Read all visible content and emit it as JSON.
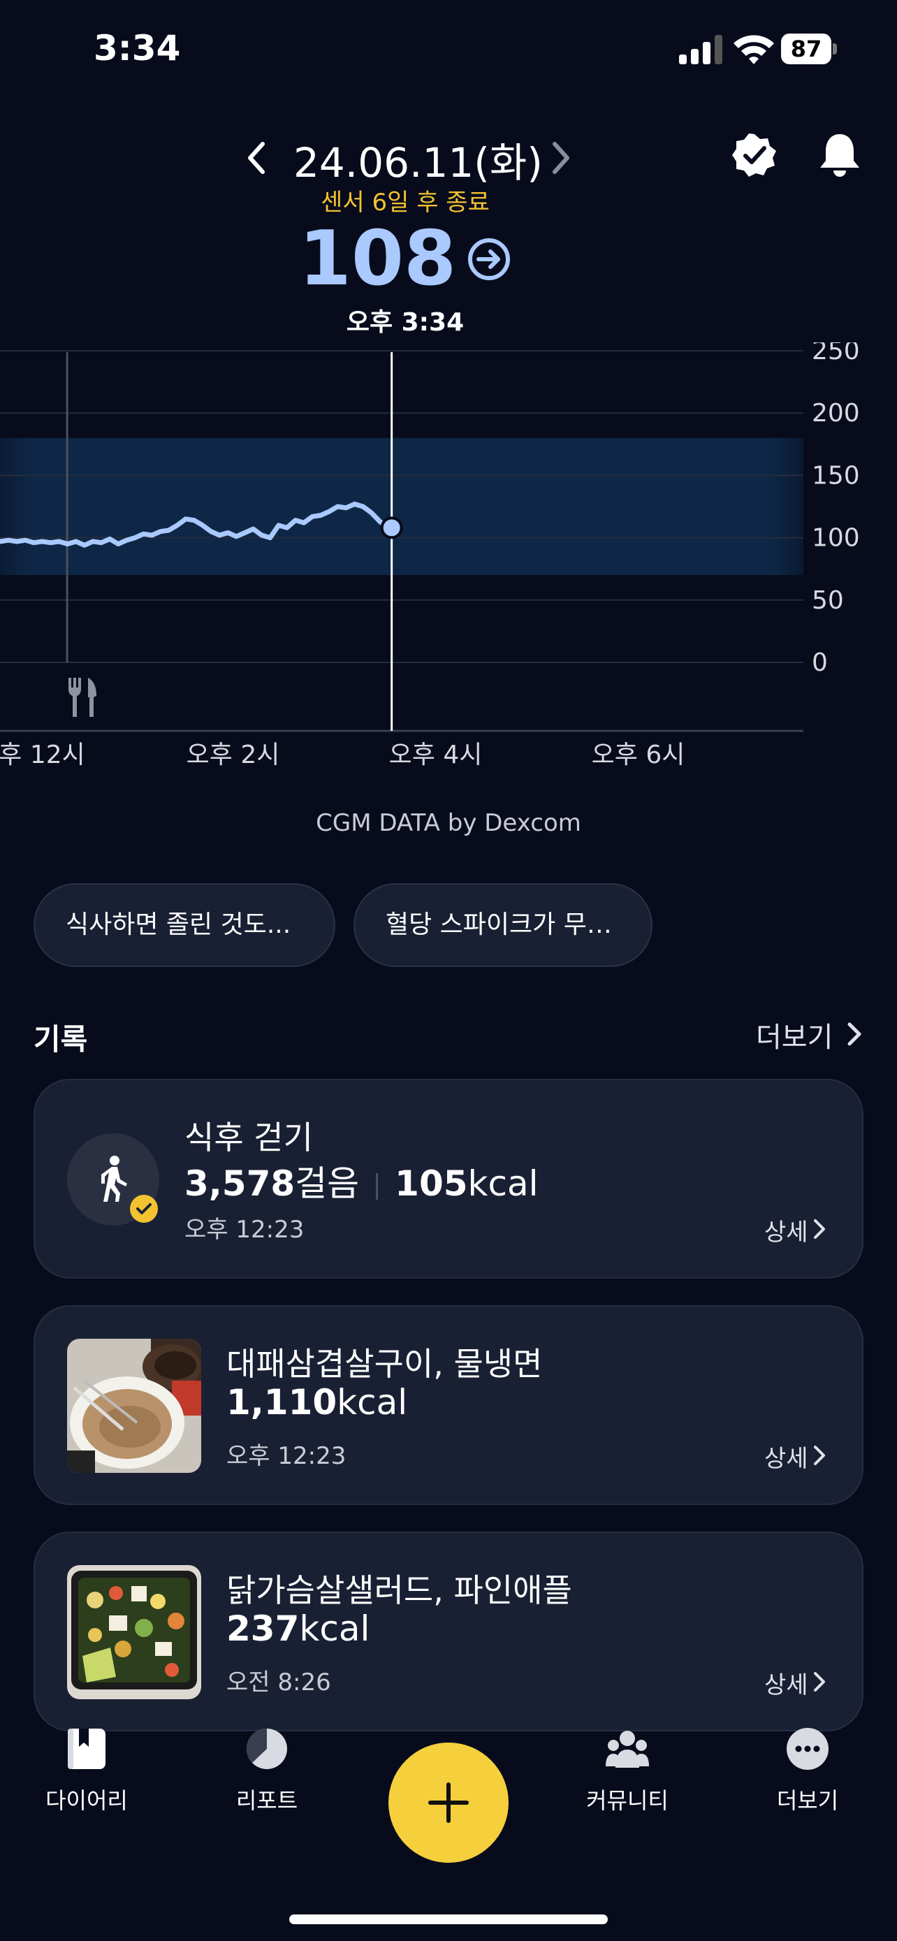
{
  "status_bar": {
    "time": "3:34",
    "battery": "87"
  },
  "header": {
    "date": "24.06.11(화)",
    "sensor_status": "센서 6일 후 종료",
    "glucose_value": "108",
    "reading_time": "오후 3:34"
  },
  "chart_data": {
    "type": "line",
    "y_axis": {
      "ticks": [
        250,
        200,
        150,
        100,
        50,
        0
      ],
      "ylim": [
        0,
        250
      ]
    },
    "x_axis": {
      "tick_labels": [
        "오후 12시",
        "오후 2시",
        "오후 4시",
        "오후 6시"
      ]
    },
    "target_range": [
      70,
      180
    ],
    "series": [
      {
        "x": [
          "11:42",
          "11:47",
          "11:52",
          "11:57",
          "12:02",
          "12:07",
          "12:12",
          "12:17",
          "12:22",
          "12:27",
          "12:32",
          "12:37",
          "12:42",
          "12:47",
          "12:52",
          "12:57",
          "13:02",
          "13:07",
          "13:12",
          "13:17",
          "13:22",
          "13:27",
          "13:32",
          "13:37",
          "13:42",
          "13:47",
          "13:52",
          "13:57",
          "14:02",
          "14:07",
          "14:12",
          "14:17",
          "14:22",
          "14:27",
          "14:32",
          "14:37",
          "14:42",
          "14:47",
          "14:52",
          "14:57",
          "15:02",
          "15:07",
          "15:12",
          "15:17",
          "15:22",
          "15:27",
          "15:32",
          "15:34"
        ],
        "values": [
          97,
          98,
          97,
          98,
          96,
          97,
          96,
          97,
          95,
          97,
          94,
          97,
          96,
          99,
          95,
          98,
          100,
          103,
          102,
          105,
          106,
          110,
          115,
          114,
          110,
          105,
          102,
          104,
          101,
          104,
          107,
          102,
          100,
          110,
          108,
          114,
          112,
          117,
          118,
          121,
          125,
          124,
          127,
          125,
          120,
          113,
          108,
          108
        ]
      }
    ],
    "current_marker": {
      "time": "15:34",
      "value": 108
    },
    "meal_marker": {
      "time": "12:23"
    }
  },
  "data_source": "CGM DATA by Dexcom",
  "chips": [
    "식사하면 졸린 것도...",
    "혈당 스파이크가 무…"
  ],
  "records": {
    "title": "기록",
    "more": "더보기",
    "detail_label": "상세",
    "items": [
      {
        "title": "식후 걷기",
        "steps": "3,578",
        "steps_unit": "걸음",
        "kcal": "105",
        "kcal_unit": "kcal",
        "time": "오후 12:23"
      },
      {
        "title": "대패삼겹살구이, 물냉면",
        "kcal": "1,110",
        "kcal_unit": "kcal",
        "time": "오후 12:23"
      },
      {
        "title": "닭가슴살샐러드, 파인애플",
        "kcal": "237",
        "kcal_unit": "kcal",
        "time": "오전 8:26"
      }
    ]
  },
  "tab_bar": {
    "tabs": [
      {
        "label": "다이어리",
        "icon": "diary-icon"
      },
      {
        "label": "리포트",
        "icon": "report-icon"
      },
      {
        "label": "커뮤니티",
        "icon": "community-icon"
      },
      {
        "label": "더보기",
        "icon": "more-icon"
      }
    ],
    "fab_icon": "plus-icon"
  },
  "colors": {
    "background": "#070b1b",
    "accent": "#f5cf3c",
    "glucose": "#a9c9ff",
    "card": "#1a2033"
  }
}
